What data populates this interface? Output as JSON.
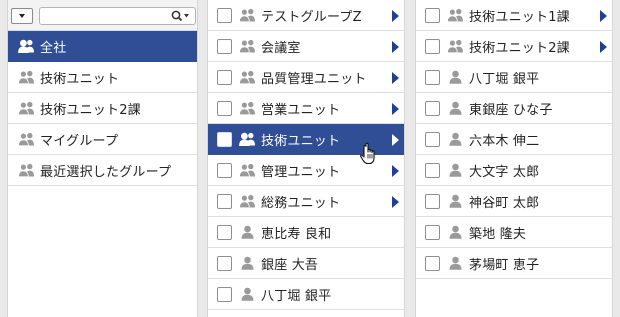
{
  "search": {
    "value": "",
    "placeholder": ""
  },
  "left_pane": {
    "items": [
      {
        "label": "全社",
        "selected": true
      },
      {
        "label": "技術ユニット",
        "selected": false
      },
      {
        "label": "技術ユニット2課",
        "selected": false
      },
      {
        "label": "マイグループ",
        "selected": false
      },
      {
        "label": "最近選択したグループ",
        "selected": false
      }
    ]
  },
  "middle_pane": {
    "items": [
      {
        "label": "テストグループZ",
        "type": "group",
        "has_children": true
      },
      {
        "label": "会議室",
        "type": "group",
        "has_children": true
      },
      {
        "label": "品質管理ユニット",
        "type": "group",
        "has_children": true
      },
      {
        "label": "営業ユニット",
        "type": "group",
        "has_children": true
      },
      {
        "label": "技術ユニット",
        "type": "group",
        "has_children": true,
        "selected": true
      },
      {
        "label": "管理ユニット",
        "type": "group",
        "has_children": true
      },
      {
        "label": "総務ユニット",
        "type": "group",
        "has_children": true
      },
      {
        "label": "恵比寿 良和",
        "type": "user",
        "has_children": false
      },
      {
        "label": "銀座 大吾",
        "type": "user",
        "has_children": false
      },
      {
        "label": "八丁堀 銀平",
        "type": "user",
        "has_children": false
      }
    ]
  },
  "right_pane": {
    "items": [
      {
        "label": "技術ユニット1課",
        "type": "group",
        "has_children": true
      },
      {
        "label": "技術ユニット2課",
        "type": "group",
        "has_children": true
      },
      {
        "label": "八丁堀 銀平",
        "type": "user",
        "has_children": false
      },
      {
        "label": "東銀座 ひな子",
        "type": "user",
        "has_children": false
      },
      {
        "label": "六本木 伸二",
        "type": "user",
        "has_children": false
      },
      {
        "label": "大文字 太郎",
        "type": "user",
        "has_children": false
      },
      {
        "label": "神谷町 太郎",
        "type": "user",
        "has_children": false
      },
      {
        "label": "築地 隆夫",
        "type": "user",
        "has_children": false
      },
      {
        "label": "茅場町 恵子",
        "type": "user",
        "has_children": false
      }
    ]
  },
  "colors": {
    "selected_bg": "#2f4e96",
    "arrow": "#1d3f9c",
    "icon_gray": "#9a9a9a",
    "pane_bg": "#ffffff",
    "app_bg": "#e9e9e9"
  },
  "icons": {
    "group": "group-icon",
    "user": "user-icon",
    "expand": "expand-arrow-icon",
    "search": "search-icon",
    "dropdown": "dropdown-icon",
    "cursor": "hand-pointer-cursor"
  }
}
